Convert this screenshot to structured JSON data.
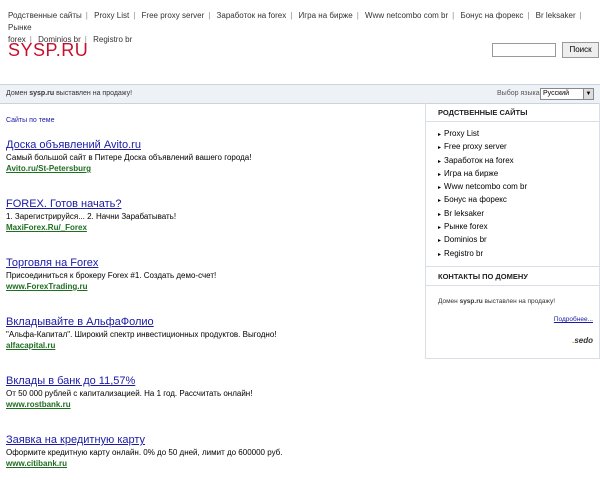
{
  "topnav": {
    "links": [
      "Родственные сайты",
      "Proxy List",
      "Free proxy server",
      "Заработок на forex",
      "Игра на бирже",
      "Www netcombo com br",
      "Бонус на форекс",
      "Br leksaker",
      "Рынке",
      "forex",
      "Dominios br",
      "Registro br"
    ]
  },
  "header": {
    "logo": "SYSP.RU",
    "search_button": "Поиск",
    "search_value": ""
  },
  "bar": {
    "sale_prefix": "Домен ",
    "sale_domain": "sysp.ru",
    "sale_suffix": " выставлен на продажу!",
    "lang_label": "Выбор языка",
    "lang_value": "Русский"
  },
  "related_topic_link": "Сайты по теме",
  "ads": [
    {
      "title": "Доска объявлений Avito.ru",
      "desc": "Самый большой сайт в Питере Доска объявлений вашего города!",
      "url": "Avito.ru/St-Petersburg"
    },
    {
      "title": "FOREX. Готов начать?",
      "desc": "1. Зарегистрируйся... 2. Начни Зарабатывать!",
      "url": "MaxiForex.Ru/_Forex"
    },
    {
      "title": "Торговля на Forex",
      "desc": "Присоединиться к брокеру Forex #1. Создать демо-счет!",
      "url": "www.ForexTrading.ru"
    },
    {
      "title": "Вкладывайте в АльфаФолио",
      "desc": "\"Альфа-Капитал\". Широкий спектр инвестиционных продуктов. Выгодно!",
      "url": "alfacapital.ru"
    },
    {
      "title": "Вклады в банк до 11,57%",
      "desc": "От 50 000 рублей с капитализацией. На 1 год. Рассчитать онлайн!",
      "url": "www.rostbank.ru"
    },
    {
      "title": "Заявка на кредитную карту",
      "desc": "Оформите кредитную карту онлайн. 0% до 50 дней, лимит до 600000 руб.",
      "url": "www.citibank.ru"
    }
  ],
  "sidebar": {
    "related_title": "РОДСТВЕННЫЕ САЙТЫ",
    "related_items": [
      "Proxy List",
      "Free proxy server",
      "Заработок на forex",
      "Игра на бирже",
      "Www netcombo com br",
      "Бонус на форекс",
      "Br leksaker",
      "Рынке forex",
      "Dominios br",
      "Registro br"
    ],
    "contacts_title": "КОНТАКТЫ ПО ДОМЕНУ",
    "contacts_prefix": "Домен ",
    "contacts_domain": "sysp.ru",
    "contacts_suffix": " выставлен на продажу!",
    "more_link": "Подробнее...",
    "brand": "sedo"
  },
  "colors": {
    "logo": "#c8102e",
    "link": "#1a1aa6",
    "ad_url": "#1f6e22",
    "bar_bg": "#eef2f7"
  }
}
